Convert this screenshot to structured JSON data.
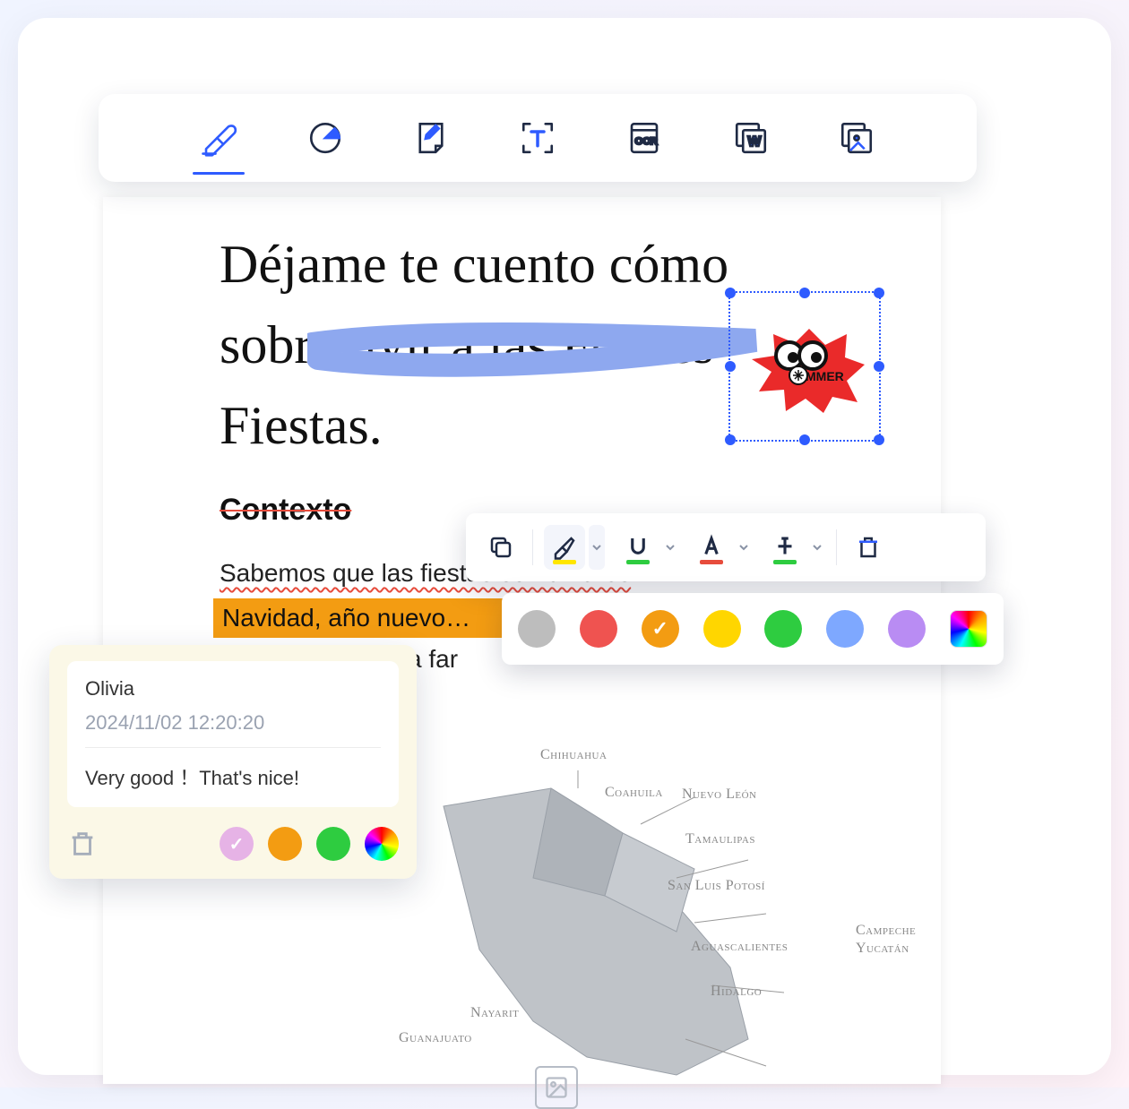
{
  "topToolbar": {
    "items": [
      {
        "name": "highlighter-icon",
        "active": true
      },
      {
        "name": "sticker-icon"
      },
      {
        "name": "note-page-icon"
      },
      {
        "name": "text-select-icon"
      },
      {
        "name": "ocr-icon",
        "label": "OCR"
      },
      {
        "name": "export-word-icon",
        "label": "W"
      },
      {
        "name": "export-image-icon"
      }
    ]
  },
  "document": {
    "title_line1": "Déjame te cuento cómo",
    "title_line2": "sobrevivir a las Felices",
    "title_line3": "Fiestas.",
    "subheading": "Contexto",
    "body_line1": "Sabemos que las fiestas son difíciles",
    "body_line2": "Navidad, año nuevo…",
    "body_line3_fragment": "a far"
  },
  "sticker": {
    "label": "MMER"
  },
  "formatBar": {
    "copy": "copy",
    "highlight_color": "#ffe600",
    "underline_color": "#2ecc40",
    "textcolor_color": "#e74c3c",
    "strike_color": "#2ecc40"
  },
  "colorRow": {
    "colors": [
      "#bdbdbd",
      "#ef5350",
      "#f39c12",
      "#ffd600",
      "#2ecc40",
      "#7ea8ff",
      "#b98cf3"
    ],
    "selected_index": 2
  },
  "comment": {
    "author": "Olivia",
    "timestamp": "2024/11/02 12:20:20",
    "text": "Very good ！That's nice!",
    "colors": [
      "#e6b3e6",
      "#f39c12",
      "#2ecc40"
    ],
    "selected_index": 0
  },
  "map": {
    "labels": [
      "Chihuahua",
      "Coahuila",
      "Nuevo León",
      "Tamaulipas",
      "San Luis Potosí",
      "Aguascalientes",
      "Hidalgo",
      "Campeche",
      "Yucatán",
      "Nayarit",
      "Guanajuato"
    ]
  }
}
